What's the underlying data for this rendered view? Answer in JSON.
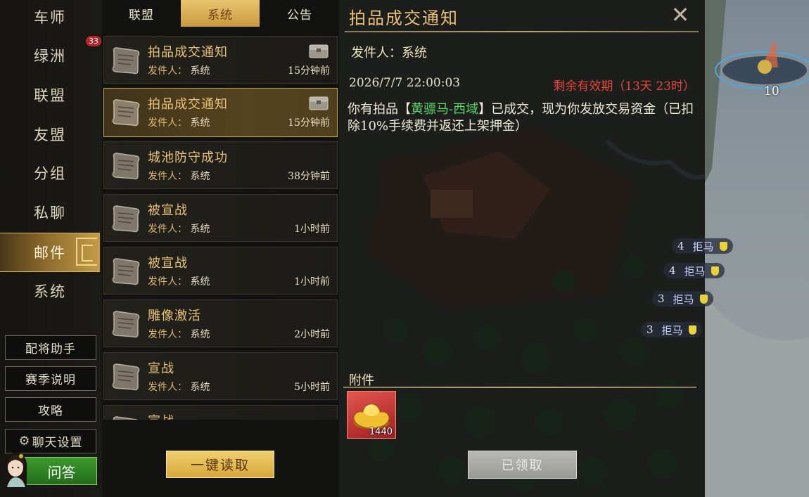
{
  "nav": {
    "items": [
      {
        "label": "车师"
      },
      {
        "label": "绿洲",
        "badge": "33"
      },
      {
        "label": "联盟"
      },
      {
        "label": "友盟"
      },
      {
        "label": "分组"
      },
      {
        "label": "私聊"
      },
      {
        "label": "邮件",
        "active": true
      },
      {
        "label": "系统"
      }
    ],
    "buttons": {
      "general_helper": "配将助手",
      "season_info": "赛季说明",
      "guide": "攻略",
      "chat_settings": "聊天设置",
      "qa": "问答"
    }
  },
  "tabs": [
    {
      "label": "联盟"
    },
    {
      "label": "系统",
      "active": true
    },
    {
      "label": "公告"
    }
  ],
  "mails": [
    {
      "title": "拍品成交通知",
      "sender_label": "发件人：",
      "sender": "系统",
      "time": "15分钟前",
      "has_attachment": true
    },
    {
      "title": "拍品成交通知",
      "sender_label": "发件人：",
      "sender": "系统",
      "time": "15分钟前",
      "has_attachment": true,
      "selected": true
    },
    {
      "title": "城池防守成功",
      "sender_label": "发件人：",
      "sender": "系统",
      "time": "38分钟前"
    },
    {
      "title": "被宣战",
      "sender_label": "发件人：",
      "sender": "系统",
      "time": "1小时前"
    },
    {
      "title": "被宣战",
      "sender_label": "发件人：",
      "sender": "系统",
      "time": "1小时前"
    },
    {
      "title": "雕像激活",
      "sender_label": "发件人：",
      "sender": "系统",
      "time": "2小时前"
    },
    {
      "title": "宣战",
      "sender_label": "发件人：",
      "sender": "系统",
      "time": "5小时前"
    },
    {
      "title": "宣战",
      "sender_label": "",
      "sender": "",
      "time": ""
    }
  ],
  "read_all_button": "一键读取",
  "detail": {
    "title": "拍品成交通知",
    "sender": "发件人：系统",
    "date": "2026/7/7 22:00:03",
    "expiry": "剩余有效期（13天 23时）",
    "body_prefix": "你有拍品【",
    "body_item": "黄骠马-西域",
    "body_suffix": "】已成交，现为你发放交易资金（已扣除10%手续费并返还上架押金）",
    "attachment_label": "附件",
    "attachment": {
      "icon": "gold-ingot-icon",
      "count": "1440"
    },
    "claimed_button": "已领取"
  },
  "map": {
    "city_level": "10",
    "labels": [
      {
        "level": "4",
        "name": "拒马"
      },
      {
        "level": "4",
        "name": "拒马"
      },
      {
        "level": "3",
        "name": "拒马"
      },
      {
        "level": "3",
        "name": "拒马"
      }
    ]
  },
  "colors": {
    "accent_gold": "#e9c277",
    "expiry_red": "#e8453a",
    "item_green": "#5cd46a",
    "badge_red": "#b3272b"
  }
}
